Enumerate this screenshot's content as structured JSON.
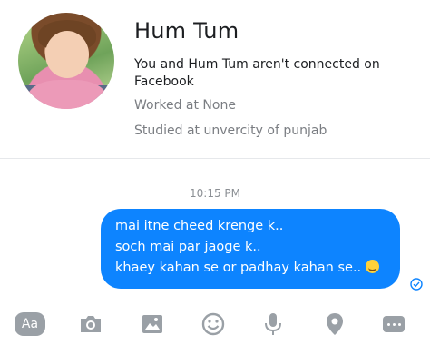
{
  "profile": {
    "name": "Hum Tum",
    "connection_text": "You and Hum Tum aren't connected on Facebook",
    "worked": "Worked at None",
    "studied": "Studied at unvercity of punjab"
  },
  "conversation": {
    "timestamp": "10:15 PM",
    "message_lines": [
      "mai itne cheed krenge k..",
      "soch mai par jaoge k..",
      "khaey kahan se or padhay kahan se.."
    ],
    "emoji": "laughing-emoji"
  },
  "toolbar": {
    "aa_label": "Aa",
    "icons": [
      "camera-icon",
      "gallery-icon",
      "emoji-icon",
      "microphone-icon",
      "location-icon",
      "more-icon"
    ]
  },
  "colors": {
    "bubble": "#0d84ff",
    "toolbar_icon": "#9aa0a6"
  }
}
